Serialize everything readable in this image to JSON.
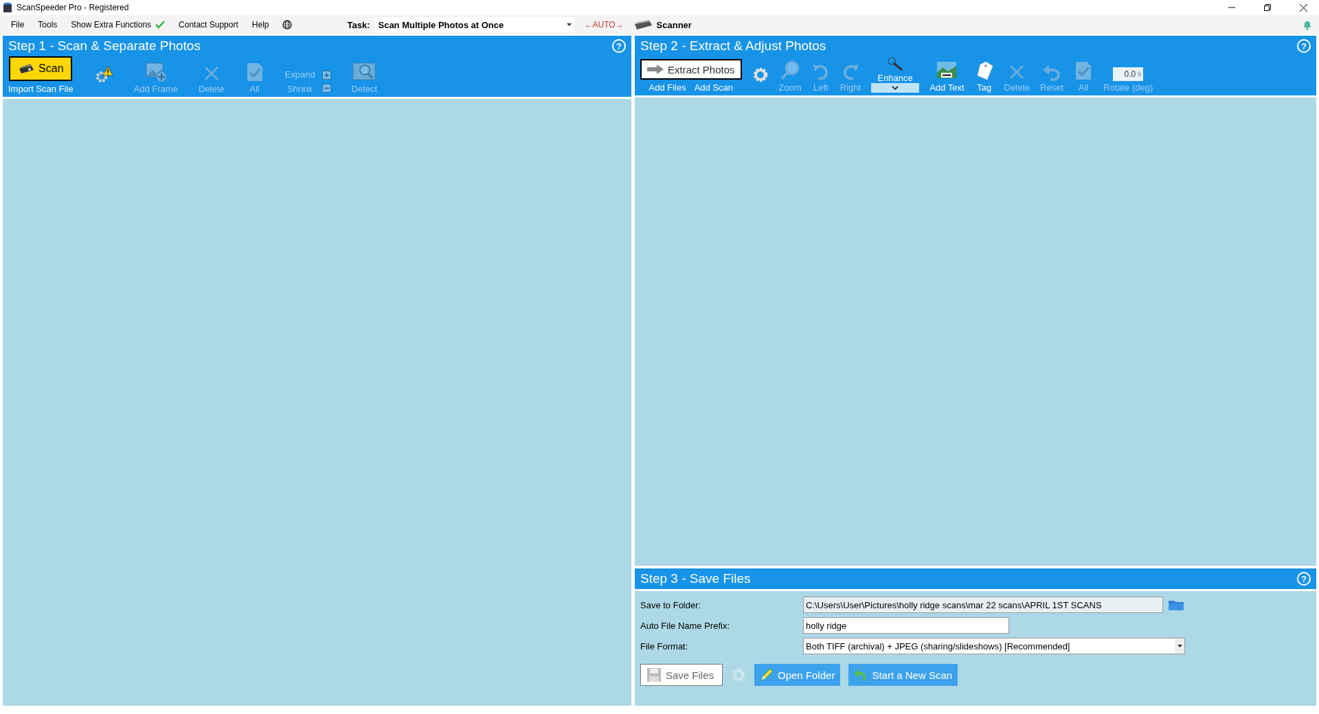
{
  "window": {
    "title": "ScanSpeeder Pro - Registered"
  },
  "menu": [
    {
      "label": "File"
    },
    {
      "label": "Tools"
    },
    {
      "label": "Show Extra Functions",
      "checked": true
    },
    {
      "label": "Contact Support"
    },
    {
      "label": "Help"
    }
  ],
  "task": {
    "label": "Task:",
    "value": "Scan Multiple Photos at Once",
    "auto": "←AUTO→",
    "scanner": "Scanner"
  },
  "step1": {
    "title": "Step 1 - Scan & Separate Photos",
    "help": "?",
    "tools": [
      {
        "kind": "scan",
        "label": "Scan",
        "link": "Import Scan File",
        "disabled": false
      },
      {
        "kind": "settings",
        "warning": true,
        "disabled": false
      },
      {
        "kind": "add-frame",
        "label": "Add Frame",
        "disabled": true
      },
      {
        "kind": "delete",
        "label": "Delete",
        "disabled": true
      },
      {
        "kind": "all",
        "label": "All",
        "disabled": true
      },
      {
        "kind": "expand-shrink",
        "label": "Expand",
        "label2": "Shrink",
        "disabled": true
      },
      {
        "kind": "detect",
        "label": "Detect",
        "disabled": true
      }
    ]
  },
  "step2": {
    "title": "Step 2 - Extract & Adjust Photos",
    "help": "?",
    "tools": [
      {
        "kind": "extract",
        "label": "Extract Photos",
        "links": [
          "Add Files",
          "Add Scan"
        ],
        "disabled": false
      },
      {
        "kind": "settings",
        "warning": false,
        "disabled": false
      },
      {
        "kind": "zoom",
        "label": "Zoom",
        "disabled": true
      },
      {
        "kind": "rotate-left",
        "label": "Left",
        "disabled": true
      },
      {
        "kind": "rotate-right",
        "label": "Right",
        "disabled": true
      },
      {
        "kind": "enhance",
        "label": "Enhance",
        "disabled": false
      },
      {
        "kind": "add-text",
        "label": "Add Text",
        "disabled": false
      },
      {
        "kind": "tag",
        "label": "Tag",
        "disabled": false
      },
      {
        "kind": "delete",
        "label": "Delete",
        "disabled": true
      },
      {
        "kind": "reset",
        "label": "Reset",
        "disabled": true
      },
      {
        "kind": "all",
        "label": "All",
        "disabled": true
      },
      {
        "kind": "rotate",
        "label": "Rotate (deg)",
        "value": "0.0",
        "disabled": true
      }
    ]
  },
  "step3": {
    "title": "Step 3 - Save Files",
    "help": "?",
    "fields": [
      {
        "kind": "folder",
        "label": "Save to Folder:",
        "value": "C:\\Users\\User\\Pictures\\holly ridge scans\\mar 22 scans\\APRIL 1ST SCANS"
      },
      {
        "kind": "text",
        "label": "Auto File Name Prefix:",
        "value": "holly ridge"
      },
      {
        "kind": "select",
        "label": "File Format:",
        "value": "Both TIFF (archival) + JPEG (sharing/slideshows) [Recommended]"
      }
    ],
    "buttons": [
      {
        "kind": "save",
        "label": "Save Files",
        "disabled": true
      },
      {
        "kind": "settings",
        "disabled": true
      },
      {
        "kind": "open",
        "label": "Open Folder",
        "disabled": false
      },
      {
        "kind": "new-scan",
        "label": "Start a New Scan",
        "disabled": false
      }
    ]
  }
}
